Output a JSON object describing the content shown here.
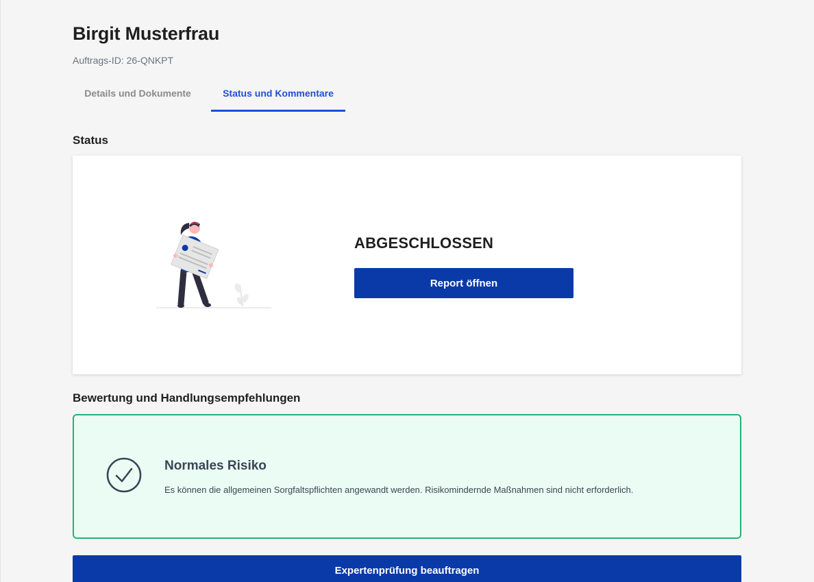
{
  "header": {
    "title": "Birgit Musterfrau",
    "order_id": "Auftrags-ID: 26-QNKPT"
  },
  "tabs": [
    {
      "label": "Details und Dokumente",
      "active": false
    },
    {
      "label": "Status und Kommentare",
      "active": true
    }
  ],
  "status": {
    "section_title": "Status",
    "state": "ABGESCHLOSSEN",
    "report_button": "Report öffnen"
  },
  "evaluation": {
    "section_title": "Bewertung und Handlungsempfehlungen",
    "risk_title": "Normales Risiko",
    "risk_description": "Es können die allgemeinen Sorgfaltspflichten angewandt werden. Risikomindernde Maßnahmen sind nicht erforderlich.",
    "icon": "check-circle-icon"
  },
  "actions": {
    "expert_button": "Expertenprüfung beauftragen"
  },
  "colors": {
    "primary": "#0a3aa8",
    "tab_active": "#1e4fd8",
    "success_border": "#22b27a",
    "success_bg": "#eafcf4"
  }
}
